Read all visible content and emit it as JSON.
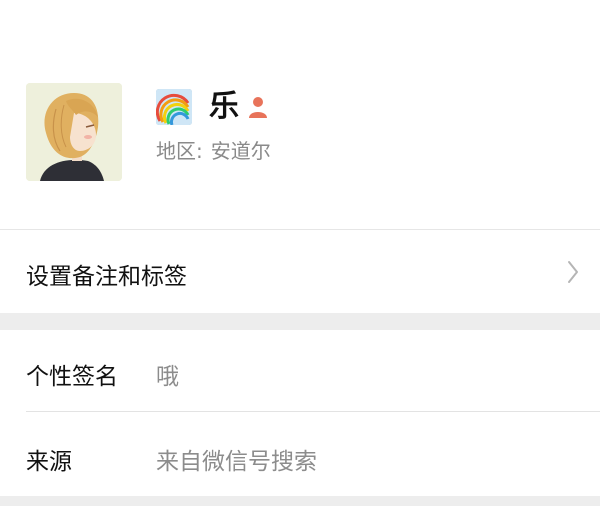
{
  "profile": {
    "nickname": "乐",
    "region_label": "地区:",
    "region_value": "安道尔",
    "avatar_icon": "anime-girl-avatar",
    "name_emoji_icon": "rainbow-icon",
    "gender_icon": "person-icon",
    "gender_icon_color": "#e8735a"
  },
  "remark_row": {
    "label": "设置备注和标签"
  },
  "details": {
    "signature_label": "个性签名",
    "signature_value": "哦",
    "source_label": "来源",
    "source_value": "来自微信号搜索"
  }
}
